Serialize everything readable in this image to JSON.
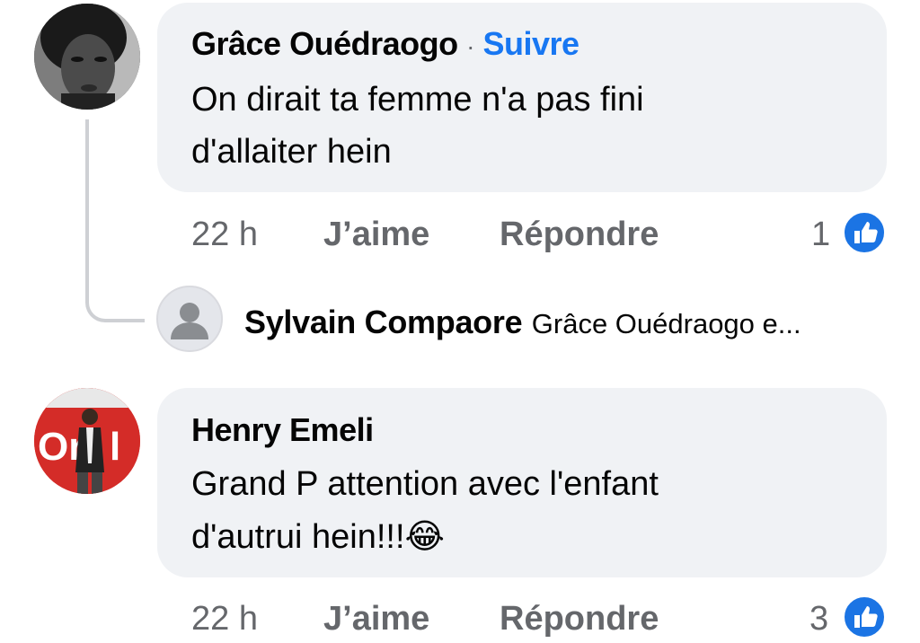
{
  "comments": [
    {
      "author": "Grâce Ouédraogo",
      "separator": "·",
      "follow_label": "Suivre",
      "text_line1": "On dirait ta femme n'a pas fini",
      "text_line2": "d'allaiter hein",
      "time": "22 h",
      "like_label": "J’aime",
      "reply_label": "Répondre",
      "reaction_count": "1",
      "reaction_icon": "thumbs-up-icon"
    },
    {
      "author": "Henry Emeli",
      "text_line1": "Grand P attention avec l'enfant",
      "text_line2": "d'autrui hein!!!",
      "emoji": "😂",
      "time": "22 h",
      "like_label": "J’aime",
      "reply_label": "Répondre",
      "reaction_count": "3",
      "reaction_icon": "thumbs-up-icon"
    }
  ],
  "reply_preview": {
    "author": "Sylvain Compaore",
    "snippet": "Grâce Ouédraogo e..."
  },
  "colors": {
    "bubble": "#f0f2f5",
    "link_blue": "#1877f2",
    "meta_grey": "#65676b",
    "like_blue": "#1b74e4"
  }
}
